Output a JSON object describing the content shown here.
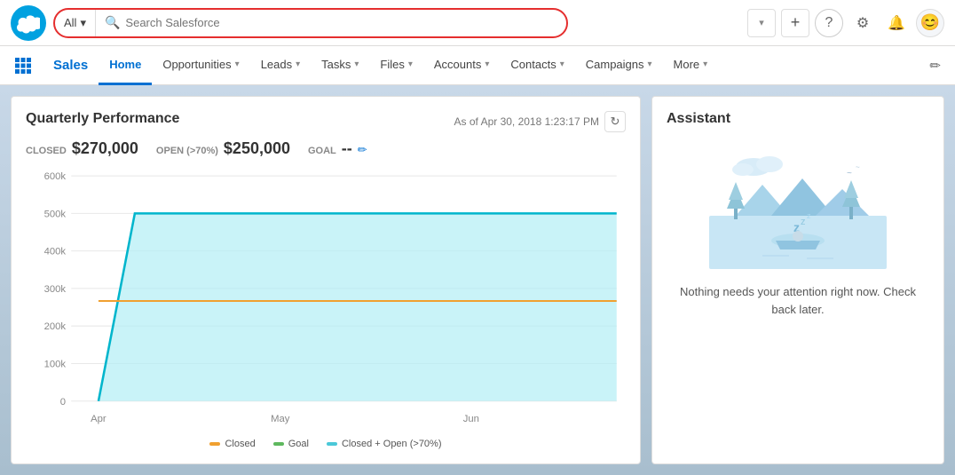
{
  "header": {
    "search_placeholder": "Search Salesforce",
    "search_all_label": "All",
    "dropdown_arrow": "▾"
  },
  "nav": {
    "brand": "Sales",
    "items": [
      {
        "label": "Home",
        "active": true,
        "has_dropdown": false
      },
      {
        "label": "Opportunities",
        "active": false,
        "has_dropdown": true
      },
      {
        "label": "Leads",
        "active": false,
        "has_dropdown": true
      },
      {
        "label": "Tasks",
        "active": false,
        "has_dropdown": true
      },
      {
        "label": "Files",
        "active": false,
        "has_dropdown": true
      },
      {
        "label": "Accounts",
        "active": false,
        "has_dropdown": true
      },
      {
        "label": "Contacts",
        "active": false,
        "has_dropdown": true
      },
      {
        "label": "Campaigns",
        "active": false,
        "has_dropdown": true
      },
      {
        "label": "More",
        "active": false,
        "has_dropdown": true
      }
    ]
  },
  "chart": {
    "title": "Quarterly Performance",
    "date_label": "As of Apr 30, 2018 1:23:17 PM",
    "closed_label": "CLOSED",
    "closed_value": "$270,000",
    "open_label": "OPEN (>70%)",
    "open_value": "$250,000",
    "goal_label": "GOAL",
    "goal_value": "--",
    "legend": [
      {
        "label": "Closed",
        "color": "#f0a030"
      },
      {
        "label": "Goal",
        "color": "#5eb85e"
      },
      {
        "label": "Closed + Open (>70%)",
        "color": "#4bc8d8"
      }
    ],
    "y_labels": [
      "600k",
      "500k",
      "400k",
      "300k",
      "200k",
      "100k",
      "0"
    ],
    "x_labels": [
      "Apr",
      "May",
      "Jun"
    ]
  },
  "assistant": {
    "title": "Assistant",
    "message": "Nothing needs your attention right now. Check back later."
  }
}
